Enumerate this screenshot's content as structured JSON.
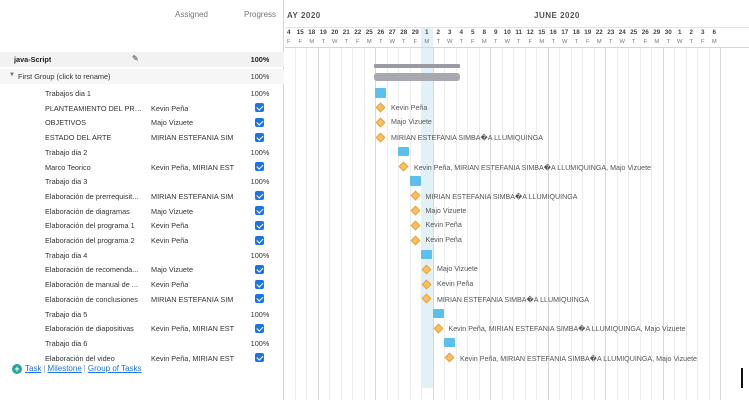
{
  "grid": {
    "header_assigned": "Assigned",
    "header_progress": "Progress",
    "project": {
      "name": "java-Script",
      "progress": "100%"
    },
    "group": {
      "name": "First Group (click to rename)",
      "progress": "100%"
    },
    "rows": [
      {
        "kind": "summary",
        "name": "Trabajos dia 1",
        "assigned": "",
        "progress": "100%"
      },
      {
        "kind": "milestone",
        "name": "PLANTEAMIENTO DEL PRO...",
        "assigned": "Kevin Peña",
        "done": true
      },
      {
        "kind": "milestone",
        "name": "OBJETIVOS",
        "assigned": "Majo Vizuete",
        "done": true
      },
      {
        "kind": "milestone",
        "name": "ESTADO DEL ARTE",
        "assigned": "MIRIAN ESTEFANIA SIM",
        "done": true
      },
      {
        "kind": "summary",
        "name": "Trabajo dia 2",
        "assigned": "",
        "progress": "100%"
      },
      {
        "kind": "milestone",
        "name": "Marco Teorico",
        "assigned": "Kevin Peña, MIRIAN EST",
        "done": true
      },
      {
        "kind": "summary",
        "name": "Trabajo dia 3",
        "assigned": "",
        "progress": "100%"
      },
      {
        "kind": "milestone",
        "name": "Elaboración de prerrequisit...",
        "assigned": "MIRIAN ESTEFANIA SIM",
        "done": true
      },
      {
        "kind": "milestone",
        "name": "Elaboración de diagramas",
        "assigned": "Majo Vizuete",
        "done": true
      },
      {
        "kind": "milestone",
        "name": "Elaboración del programa 1",
        "assigned": "Kevin Peña",
        "done": true
      },
      {
        "kind": "milestone",
        "name": "Elaboración del programa 2",
        "assigned": "Kevin Peña",
        "done": true
      },
      {
        "kind": "summary",
        "name": "Trabajo dia 4",
        "assigned": "",
        "progress": "100%"
      },
      {
        "kind": "milestone",
        "name": "Elaboración de recomenda...",
        "assigned": "Majo Vizuete",
        "done": true
      },
      {
        "kind": "milestone",
        "name": "Elaboración de manual de ...",
        "assigned": "Kevin Peña",
        "done": true
      },
      {
        "kind": "milestone",
        "name": "Elaboración de conclusiones",
        "assigned": "MIRIAN ESTEFANIA SIM",
        "done": true
      },
      {
        "kind": "summary",
        "name": "Trabajo dia 5",
        "assigned": "",
        "progress": "100%"
      },
      {
        "kind": "milestone",
        "name": "Elaboración de diapositivas",
        "assigned": "Kevin Peña, MIRIAN EST",
        "done": true
      },
      {
        "kind": "summary",
        "name": "Trabajo dia 6",
        "assigned": "",
        "progress": "100%"
      },
      {
        "kind": "milestone",
        "name": "Elaboración del video",
        "assigned": "Kevin Peña, MIRIAN EST",
        "done": true
      }
    ],
    "add_links": {
      "task": "Task",
      "milestone": "Milestone",
      "group": "Group of Tasks"
    }
  },
  "gantt": {
    "months": [
      "AY 2020",
      "JUNE 2020"
    ],
    "days": [
      "4",
      "15",
      "18",
      "19",
      "20",
      "21",
      "22",
      "25",
      "26",
      "27",
      "28",
      "29",
      "1",
      "2",
      "3",
      "4",
      "5",
      "8",
      "9",
      "10",
      "11",
      "12",
      "15",
      "16",
      "17",
      "18",
      "19",
      "22",
      "23",
      "24",
      "25",
      "26",
      "29",
      "30",
      "1",
      "2",
      "3",
      "6"
    ],
    "dows": [
      "F",
      "F",
      "M",
      "T",
      "W",
      "T",
      "F",
      "M",
      "T",
      "W",
      "T",
      "F",
      "M",
      "T",
      "W",
      "T",
      "F",
      "M",
      "T",
      "W",
      "T",
      "F",
      "M",
      "T",
      "W",
      "T",
      "F",
      "M",
      "T",
      "W",
      "T",
      "F",
      "M",
      "T",
      "W",
      "T",
      "F",
      "M"
    ],
    "today_index": 12,
    "task_bar_columns": [
      8,
      10,
      11,
      12,
      13,
      14
    ],
    "milestone_columns": [
      8,
      8,
      8,
      10,
      11,
      11,
      11,
      11,
      12,
      12,
      12,
      13,
      14
    ],
    "milestone_labels": [
      "Kevin Peña",
      "Majo Vizuete",
      "MIRIAN ESTEFANIA SIMBA�A LLUMIQUINGA",
      "Kevin Peña, MIRIAN ESTEFANIA SIMBA�A LLUMIQUINGA, Majo Vizuete",
      "MIRIAN ESTEFANIA SIMBA�A LLUMIQUINGA",
      "Majo Vizuete",
      "Kevin Peña",
      "Kevin Peña",
      "Majo Vizuete",
      "Kevin Peña",
      "MIRIAN ESTEFANIA SIMBA�A LLUMIQUINGA",
      "Kevin Peña, MIRIAN ESTEFANIA SIMBA�A LLUMIQUINGA, Majo Vizuete",
      "Kevin Peña, MIRIAN ESTEFANIA SIMBA�A LLUMIQUINGA, Majo Vizuete"
    ],
    "colors": {
      "task": "#5bc0eb",
      "milestone": "#fbc15e",
      "summary": "#a8a8b0",
      "today": "#add8e6"
    }
  }
}
